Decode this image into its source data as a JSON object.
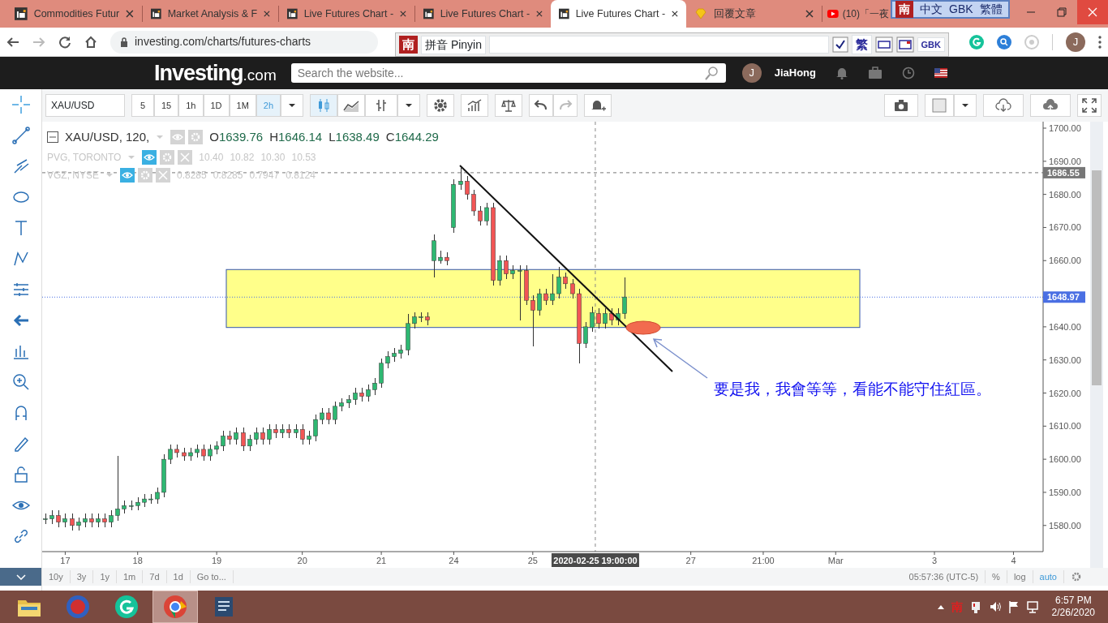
{
  "browser": {
    "tabs": [
      {
        "title": "Commodities Futur",
        "kind": "site",
        "selected": false,
        "clipped": false
      },
      {
        "title": "Market Analysis & F",
        "kind": "site",
        "selected": false,
        "clipped": false
      },
      {
        "title": "Live Futures Chart -",
        "kind": "site",
        "selected": false,
        "clipped": false
      },
      {
        "title": "Live Futures Chart -",
        "kind": "site",
        "selected": false,
        "clipped": false
      },
      {
        "title": "Live Futures Chart -",
        "kind": "site",
        "selected": true,
        "clipped": false
      },
      {
        "title": "回覆文章",
        "kind": "gem",
        "selected": false,
        "clipped": false
      },
      {
        "title": "(10)「一夜",
        "kind": "video",
        "selected": false,
        "clipped": true
      }
    ],
    "forward_disabled": true,
    "url": "investing.com/charts/futures-charts",
    "avatar": "J"
  },
  "ime": {
    "status": [
      "南",
      "中文",
      "GBK",
      "繁體"
    ],
    "mode": [
      "南",
      "拼音 Pinyin"
    ],
    "checked": true,
    "buttons": [
      "繁",
      "GBK"
    ]
  },
  "site": {
    "logo": "Investing",
    "logo_suffix": ".com",
    "search_placeholder": "Search the website...",
    "avatar": "J",
    "user": "JiaHong"
  },
  "toolbar": {
    "symbol": "XAU/USD",
    "intervals": [
      {
        "label": "5",
        "selected": false
      },
      {
        "label": "15",
        "selected": false
      },
      {
        "label": "1h",
        "selected": false
      },
      {
        "label": "1D",
        "selected": false
      },
      {
        "label": "1M",
        "selected": false
      },
      {
        "label": "2h",
        "selected": true
      }
    ],
    "redo_disabled": true
  },
  "legend": {
    "title": "XAU/USD, 120,",
    "ohlc": [
      {
        "key": "O",
        "value": "1639.76"
      },
      {
        "key": "H",
        "value": "1646.14"
      },
      {
        "key": "L",
        "value": "1638.49"
      },
      {
        "key": "C",
        "value": "1644.29"
      }
    ],
    "studies": [
      {
        "name": "PVG, TORONTO",
        "values": [
          "10.40",
          "10.82",
          "10.30",
          "10.53"
        ]
      },
      {
        "name": "VGZ, NYSE",
        "values": [
          "0.8285",
          "0.8285",
          "0.7947",
          "0.8124"
        ]
      }
    ]
  },
  "chart": {
    "annotation": "要是我，我會等等，看能不能守住紅區。",
    "chart_data": {
      "type": "candlestick",
      "ylim": [
        1572.1,
        1701.96
      ],
      "yticks": [
        {
          "value": 1580,
          "label": "1580.00"
        },
        {
          "value": 1590,
          "label": "1590.00"
        },
        {
          "value": 1600,
          "label": "1600.00"
        },
        {
          "value": 1610,
          "label": "1610.00"
        },
        {
          "value": 1620,
          "label": "1620.00"
        },
        {
          "value": 1630,
          "label": "1630.00"
        },
        {
          "value": 1640,
          "label": "1640.00"
        },
        {
          "value": 1660,
          "label": "1660.00"
        },
        {
          "value": 1670,
          "label": "1670.00"
        },
        {
          "value": 1680,
          "label": "1680.00"
        },
        {
          "value": 1690,
          "label": "1690.00"
        },
        {
          "value": 1700,
          "label": "1700.00"
        }
      ],
      "categories": [
        null,
        null,
        null,
        "17",
        null,
        null,
        null,
        null,
        null,
        null,
        null,
        null,
        null,
        null,
        "18",
        null,
        null,
        null,
        null,
        null,
        null,
        null,
        null,
        null,
        null,
        null,
        "19",
        null,
        null,
        null,
        null,
        null,
        null,
        null,
        null,
        null,
        null,
        null,
        null,
        "20",
        null,
        null,
        null,
        null,
        null,
        null,
        null,
        null,
        null,
        null,
        null,
        "21",
        null,
        null,
        null,
        null,
        null,
        null,
        null,
        null,
        null,
        null,
        "24",
        null,
        null,
        null,
        null,
        null,
        null,
        null,
        null,
        null,
        null,
        null,
        "25",
        null,
        null,
        null,
        null,
        null,
        null,
        null,
        null,
        null,
        null,
        null,
        null,
        null,
        null,
        null,
        null,
        null,
        null,
        null,
        null,
        null,
        null,
        null,
        "27",
        null,
        null,
        null,
        null,
        null,
        null,
        null,
        null,
        null,
        null,
        "21:00",
        null,
        null,
        null,
        null,
        null,
        null,
        null,
        null,
        null,
        null,
        "Mar",
        null,
        null,
        null,
        null,
        null,
        null,
        null,
        null,
        null,
        null,
        null,
        null,
        null,
        null,
        "3",
        null,
        null,
        null,
        null,
        null,
        null,
        null,
        null,
        null,
        null,
        null,
        "4",
        null,
        null,
        null,
        null
      ],
      "ohlc": [
        [
          1582,
          1583.5,
          1580.5,
          1582
        ],
        [
          1582,
          1584.5,
          1580.5,
          1583
        ],
        [
          1583,
          1584.5,
          1579.5,
          1581
        ],
        [
          1581,
          1583.5,
          1579.5,
          1582
        ],
        [
          1582,
          1583.5,
          1578.5,
          1580
        ],
        [
          1580,
          1582.5,
          1578.5,
          1581
        ],
        [
          1581,
          1583.5,
          1579.5,
          1582
        ],
        [
          1582,
          1583.5,
          1579.5,
          1581
        ],
        [
          1581,
          1583.5,
          1579.5,
          1582
        ],
        [
          1582,
          1583.5,
          1579.5,
          1581
        ],
        [
          1581,
          1584.5,
          1579.5,
          1583
        ],
        [
          1583,
          1601,
          1581.5,
          1585
        ],
        [
          1585,
          1587.5,
          1583.5,
          1586
        ],
        [
          1586,
          1587.5,
          1584.5,
          1586
        ],
        [
          1586,
          1588.5,
          1584.5,
          1587
        ],
        [
          1587,
          1589.5,
          1585.5,
          1588
        ],
        [
          1588,
          1589.5,
          1586.5,
          1588
        ],
        [
          1588,
          1591.5,
          1586.5,
          1590
        ],
        [
          1590,
          1601.5,
          1588.5,
          1600
        ],
        [
          1600,
          1604.5,
          1598.5,
          1603
        ],
        [
          1603,
          1604.5,
          1600.5,
          1602
        ],
        [
          1602,
          1603.5,
          1599.5,
          1601
        ],
        [
          1601,
          1603.5,
          1599.5,
          1602
        ],
        [
          1602,
          1604.5,
          1600.5,
          1603
        ],
        [
          1603,
          1604.5,
          1599.5,
          1601
        ],
        [
          1601,
          1604.5,
          1599.5,
          1603
        ],
        [
          1603,
          1605.5,
          1601.5,
          1604
        ],
        [
          1604,
          1608.5,
          1602.5,
          1607
        ],
        [
          1607,
          1608.5,
          1604.5,
          1606
        ],
        [
          1606,
          1609.5,
          1604.5,
          1608
        ],
        [
          1608,
          1609.5,
          1602.5,
          1604
        ],
        [
          1604,
          1607.5,
          1602.5,
          1606
        ],
        [
          1606,
          1609.5,
          1604.5,
          1608
        ],
        [
          1608,
          1609.5,
          1604.5,
          1606
        ],
        [
          1606,
          1610.5,
          1604.5,
          1609
        ],
        [
          1609,
          1610.5,
          1606.5,
          1608
        ],
        [
          1608,
          1610.5,
          1606.5,
          1609
        ],
        [
          1609,
          1610.5,
          1606.5,
          1608
        ],
        [
          1608,
          1610.5,
          1606.5,
          1609
        ],
        [
          1609,
          1610.5,
          1604.5,
          1606
        ],
        [
          1606,
          1608.5,
          1604.5,
          1607
        ],
        [
          1607,
          1613.5,
          1605.5,
          1612
        ],
        [
          1612,
          1615.5,
          1610.5,
          1614
        ],
        [
          1614,
          1615.5,
          1610.5,
          1612
        ],
        [
          1612,
          1617.5,
          1610.5,
          1616
        ],
        [
          1616,
          1618.5,
          1614.5,
          1617
        ],
        [
          1617,
          1619.5,
          1615.5,
          1618
        ],
        [
          1618,
          1621.5,
          1616.5,
          1620
        ],
        [
          1620,
          1621.5,
          1617.5,
          1619
        ],
        [
          1619,
          1622.5,
          1617.5,
          1621
        ],
        [
          1621,
          1624.5,
          1619.5,
          1623
        ],
        [
          1623,
          1630.5,
          1621.5,
          1629
        ],
        [
          1629,
          1632.5,
          1627.5,
          1631
        ],
        [
          1631,
          1633.5,
          1629.5,
          1632
        ],
        [
          1632,
          1634.5,
          1630.5,
          1633
        ],
        [
          1633,
          1644,
          1631.5,
          1641
        ],
        [
          1641,
          1644.5,
          1639.5,
          1643
        ],
        [
          1643,
          1644.5,
          1641.5,
          1643
        ],
        [
          1643,
          1644.5,
          1640.5,
          1642
        ],
        [
          1660,
          1668,
          1655,
          1666
        ],
        [
          1660,
          1663,
          1659,
          1661
        ],
        [
          1661,
          1662.5,
          1658.5,
          1660
        ],
        [
          1670,
          1684.5,
          1668.5,
          1683
        ],
        [
          1683,
          1688,
          1681.5,
          1684
        ],
        [
          1684,
          1685.5,
          1678.5,
          1680
        ],
        [
          1680,
          1681.5,
          1673.5,
          1675
        ],
        [
          1675,
          1676.5,
          1670.5,
          1672
        ],
        [
          1672,
          1677.5,
          1670.5,
          1676
        ],
        [
          1676,
          1677.5,
          1652.5,
          1654
        ],
        [
          1654,
          1661.5,
          1652.5,
          1660
        ],
        [
          1660,
          1661.5,
          1654.5,
          1656
        ],
        [
          1656,
          1658.5,
          1654.5,
          1657
        ],
        [
          1657,
          1658.5,
          1642,
          1657
        ],
        [
          1657,
          1658.5,
          1646.5,
          1648
        ],
        [
          1648,
          1649.5,
          1634,
          1645
        ],
        [
          1645,
          1651.5,
          1643.5,
          1650
        ],
        [
          1650,
          1651.5,
          1646.5,
          1648
        ],
        [
          1648,
          1656,
          1646.5,
          1650
        ],
        [
          1650,
          1658,
          1648.5,
          1655
        ],
        [
          1655,
          1656.5,
          1651.5,
          1653
        ],
        [
          1653,
          1654.5,
          1648.5,
          1650
        ],
        [
          1650,
          1651.5,
          1629,
          1635
        ],
        [
          1635,
          1641.5,
          1633.5,
          1640
        ],
        [
          1639.76,
          1646.14,
          1638.49,
          1644.29
        ],
        [
          1644,
          1645.5,
          1639.5,
          1641
        ],
        [
          1641,
          1645.5,
          1639.5,
          1644
        ],
        [
          1644,
          1645.5,
          1640.5,
          1642
        ],
        [
          1642,
          1645.5,
          1640.5,
          1644
        ],
        [
          1644,
          1655,
          1642.5,
          1649
        ],
        null,
        null,
        null,
        null,
        null,
        null,
        null,
        null,
        null,
        null,
        null,
        null,
        null,
        null,
        null,
        null,
        null,
        null,
        null,
        null,
        null,
        null,
        null,
        null,
        null,
        null,
        null,
        null,
        null,
        null,
        null,
        null,
        null,
        null,
        null,
        null,
        null,
        null,
        null,
        null,
        null,
        null,
        null,
        null,
        null,
        null,
        null,
        null,
        null,
        null,
        null,
        null,
        null,
        null,
        null,
        null,
        null,
        null,
        null,
        null,
        null,
        null,
        null
      ],
      "ref_lines": [
        {
          "axis": "y",
          "value": 1686.55,
          "label": "1686.55",
          "color": "#777777"
        },
        {
          "axis": "y",
          "value": 1648.97,
          "label": "1648.97",
          "color": "#4a6fe3"
        }
      ],
      "bands": [
        {
          "axis": "y",
          "from": 1639.8,
          "to": 1657.3,
          "color": "#ffff8a"
        }
      ],
      "annotations": [
        "2020-02-25 19:00:00"
      ]
    }
  },
  "ranges": [
    "10y",
    "3y",
    "1y",
    "1m",
    "7d",
    "1d",
    "Go to..."
  ],
  "status": {
    "time": "05:57:36 (UTC-5)",
    "options": [
      {
        "label": "%",
        "selected": false
      },
      {
        "label": "log",
        "selected": false
      },
      {
        "label": "auto",
        "selected": true
      }
    ]
  },
  "taskbar": {
    "apps": [
      {
        "kind": "folder",
        "selected": false
      },
      {
        "kind": "ime",
        "selected": false
      },
      {
        "kind": "grammar",
        "selected": false
      },
      {
        "kind": "browser",
        "selected": true
      },
      {
        "kind": "notes",
        "selected": false
      }
    ],
    "tray_ime": "南",
    "time": "6:57 PM",
    "date": "2/26/2020"
  }
}
